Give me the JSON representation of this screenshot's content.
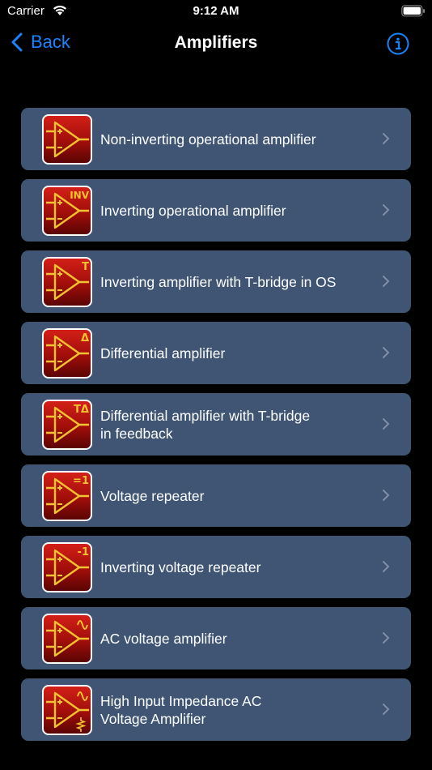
{
  "status": {
    "carrier": "Carrier",
    "time": "9:12 AM"
  },
  "nav": {
    "back_label": "Back",
    "title": "Amplifiers"
  },
  "items": [
    {
      "label": "Non-inverting operational amplifier",
      "badge": ""
    },
    {
      "label": "Inverting operational amplifier",
      "badge": "INV"
    },
    {
      "label": "Inverting amplifier with T-bridge in OS",
      "badge": "T"
    },
    {
      "label": "Differential amplifier",
      "badge": "Δ"
    },
    {
      "label": "Differential amplifier with T-bridge\nin feedback",
      "badge": "TΔ"
    },
    {
      "label": "Voltage repeater",
      "badge": "=1"
    },
    {
      "label": "Inverting voltage repeater",
      "badge": "-1"
    },
    {
      "label": "AC voltage amplifier",
      "badge": ""
    },
    {
      "label": "High Input Impedance AC\nVoltage Amplifier",
      "badge": ""
    }
  ],
  "colors": {
    "accent": "#1a84ff",
    "row_bg": "#3f5573",
    "icon_red": "#c41a14",
    "icon_symbol": "#f2c230"
  }
}
